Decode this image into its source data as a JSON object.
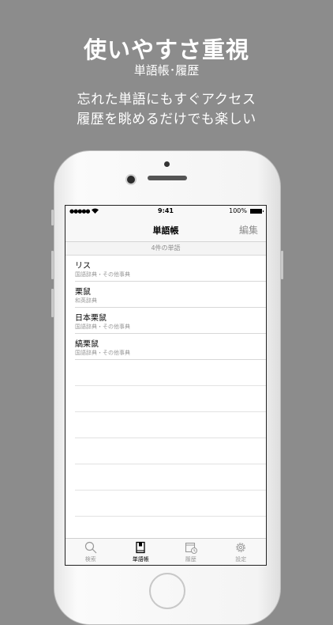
{
  "promo": {
    "title": "使いやすさ重視",
    "subtitle": "単語帳･履歴",
    "desc_line1": "忘れた単語にもすぐアクセス",
    "desc_line2": "履歴を眺めるだけでも楽しい"
  },
  "status_bar": {
    "signal": "●●●●●",
    "time": "9:41",
    "battery": "100%"
  },
  "nav": {
    "title": "単語帳",
    "edit_label": "編集"
  },
  "list": {
    "count_label": "4件の単語",
    "items": [
      {
        "word": "リス",
        "dict": "国語辞典・その他事典"
      },
      {
        "word": "栗鼠",
        "dict": "和英辞典"
      },
      {
        "word": "日本栗鼠",
        "dict": "国語辞典・その他事典"
      },
      {
        "word": "縞栗鼠",
        "dict": "国語辞典・その他事典"
      }
    ]
  },
  "tabs": [
    {
      "label": "検索",
      "icon": "search-icon"
    },
    {
      "label": "単語帳",
      "icon": "book-icon"
    },
    {
      "label": "履歴",
      "icon": "history-icon"
    },
    {
      "label": "設定",
      "icon": "gear-icon"
    }
  ],
  "colors": {
    "background": "#8c8c8c",
    "tab_active": "#000000",
    "tab_inactive": "#9a9a9a"
  }
}
